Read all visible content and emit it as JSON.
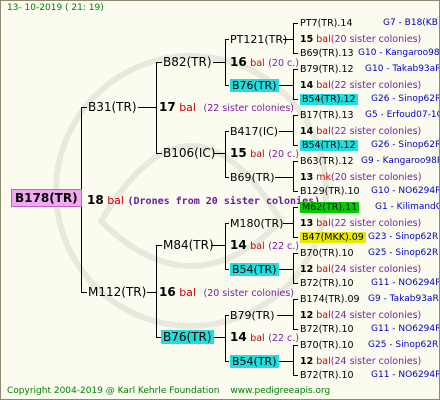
{
  "header": {
    "date": "13- 10-2019 ( 21: 19)"
  },
  "footer": {
    "copyright": "Copyright 2004-2019 @ Karl Kehrle Foundation",
    "site": "www.pedigreeapis.org"
  },
  "root": {
    "id": "B178(TR)",
    "num": "18",
    "bal": "bal",
    "note": "(Drones from 20 sister colonies)"
  },
  "gen1": {
    "a": {
      "id": "B31(TR)",
      "num": "17",
      "bal": "bal",
      "note": "(22 sister colonies)"
    },
    "b": {
      "id": "M112(TR)",
      "num": "16",
      "bal": "bal",
      "note": "(20 sister colonies)"
    }
  },
  "gen2": {
    "a1": {
      "id": "B82(TR)",
      "num": "16",
      "bal": "bal",
      "note": "(20 c.)"
    },
    "a2": {
      "id": "B106(IC)",
      "num": "15",
      "bal": "bal",
      "note": "(20 c.)"
    },
    "b1": {
      "id": "M84(TR)",
      "num": "14",
      "bal": "bal",
      "note": "(22 c.)"
    },
    "b2": {
      "id": "B76(TR)",
      "num": "14",
      "bal": "bal",
      "note": "(22 c.)"
    }
  },
  "gen3": {
    "g1": {
      "id": "PT121(TR)"
    },
    "g2": {
      "id": "B76(TR)"
    },
    "g3": {
      "id": "B417(IC)"
    },
    "g4": {
      "id": "B69(TR)"
    },
    "g5": {
      "id": "M180(TR)"
    },
    "g6": {
      "id": "B54(TR)"
    },
    "g7": {
      "id": "B79(TR)"
    },
    "g8": {
      "id": "B54(TR)"
    }
  },
  "gen4": [
    {
      "id": "PT7(TR).14",
      "right": "G7 - B18(KB)"
    },
    {
      "num": "15",
      "bal": "bal",
      "note": "(20 sister colonies)"
    },
    {
      "id": "B69(TR).13",
      "right": "G10 - Kangaroo98R"
    },
    {
      "id": "B79(TR).12",
      "right": "G10 - Takab93aR"
    },
    {
      "num": "14",
      "bal": "bal",
      "note": "(22 sister colonies)"
    },
    {
      "id": "B54(TR).12",
      "right": "G26 - Sinop62R"
    },
    {
      "id": "B17(TR).13",
      "right": "G5 - Erfoud07-1Q"
    },
    {
      "num": "14",
      "bal": "bal",
      "note": "(22 sister colonies)"
    },
    {
      "id": "B54(TR).12",
      "right": "G26 - Sinop62R"
    },
    {
      "id": "B63(TR).12",
      "right": "G9 - Kangaroo98R"
    },
    {
      "num": "13",
      "bal": "mk",
      "note": "(20 sister colonies)"
    },
    {
      "id": "B129(TR).10",
      "right": "G10 - NO6294R"
    },
    {
      "id": "M62(TR).11",
      "right": "G1 - KilimandQ"
    },
    {
      "num": "13",
      "bal": "bal",
      "note": "(22 sister colonies)"
    },
    {
      "id": "B47(MKK).09",
      "right": "G23 - Sinop62R"
    },
    {
      "id": "B70(TR).10",
      "right": "G25 - Sinop62R"
    },
    {
      "num": "12",
      "bal": "bal",
      "note": "(24 sister colonies)"
    },
    {
      "id": "B72(TR).10",
      "right": "G11 - NO6294R"
    },
    {
      "id": "B174(TR).09",
      "right": "G9 - Takab93aR"
    },
    {
      "num": "12",
      "bal": "bal",
      "note": "(24 sister colonies)"
    },
    {
      "id": "B72(TR).10",
      "right": "G11 - NO6294R"
    },
    {
      "id": "B70(TR).10",
      "right": "G25 - Sinop62R"
    },
    {
      "num": "12",
      "bal": "bal",
      "note": "(24 sister colonies)"
    },
    {
      "id": "B72(TR).10",
      "right": "G11 - NO6294R"
    }
  ]
}
